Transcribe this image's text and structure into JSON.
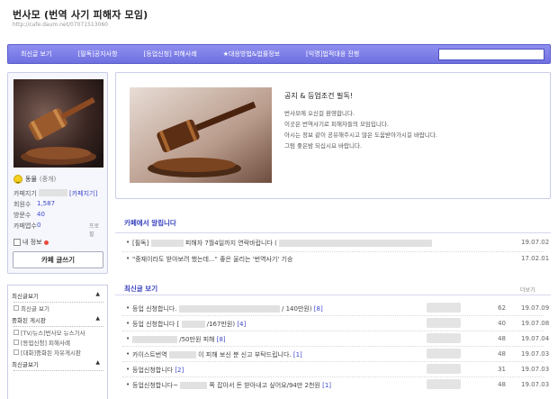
{
  "header": {
    "title": "번사모 (번역 사기 피해자 모임)",
    "url": "http://cafe.daum.net/07071513060"
  },
  "nav": {
    "items": [
      "최신글 보기",
      "[필독]공지사항",
      "[등업신청] 피해사례",
      "★대응방법&법률정보",
      "[익명]법적대응 진행"
    ],
    "search_placeholder": ""
  },
  "profile": {
    "level_label": "동물",
    "level_suffix": "(중개)",
    "stats": [
      {
        "key": "카페지기",
        "value": "[카페지기]"
      },
      {
        "key": "회원수",
        "value": "1,587"
      },
      {
        "key": "방문수",
        "value": "40"
      },
      {
        "key": "카페앱수",
        "value": "0"
      }
    ],
    "manage": "프로필",
    "my_write": "내 정보",
    "write_button": "카페 글쓰기"
  },
  "menu": {
    "sections": [
      {
        "title": "최신글보기",
        "items": [
          "최신글 보기"
        ]
      },
      {
        "title": "중화된 게시판",
        "items": [
          "[TV/뉴스]번사모 뉴스기사",
          "[등업신청] 피해사례",
          "[대화]중화된 자유게시판"
        ]
      },
      {
        "title": "최신글보기",
        "items": []
      }
    ]
  },
  "notice": {
    "title": "공지 & 등업조건 필독!",
    "lines": [
      "번사모에 오신걸 환영합니다.",
      "이곳은 번역사기로 피해자들의 모임입니다.",
      "아시는 정보 같이 공유해주시고 많은 도움받아가시길 바랍니다.",
      "그럼 좋은밤 되십시요 바랍니다."
    ]
  },
  "cafe_notice": {
    "title": "카페에서 알립니다",
    "rows": [
      {
        "text": "[필독]",
        "after": "피해자 7월4일까지 연락바랍니다 (",
        "date": "19.07.02"
      },
      {
        "text": "\"중재이라도 받아보려 했는데...\" 좋은 울리는 '번역사기' 기승",
        "after": "",
        "date": "17.02.01"
      }
    ]
  },
  "recent": {
    "title": "최신글 보기",
    "more": "더보기",
    "rows": [
      {
        "text": "등업 신청합니다.",
        "mid": "/ 140만원)",
        "count": "[8]",
        "num": "62",
        "date": "19.07.09"
      },
      {
        "text": "등업 신청합니다 [",
        "mid": "/167만원)",
        "count": "[4]",
        "num": "40",
        "date": "19.07.08"
      },
      {
        "text": "",
        "mid": "/50만원 피해",
        "count": "[8]",
        "num": "48",
        "date": "19.07.04"
      },
      {
        "text": "카이스트번역",
        "mid": "이 피해 보신 분 신고 부탁드립니다.",
        "count": "[1]",
        "num": "48",
        "date": "19.07.03"
      },
      {
        "text": "등업신청합니다",
        "mid": "",
        "count": "[2]",
        "num": "31",
        "date": "19.07.03"
      },
      {
        "text": "등업신청합니다~",
        "mid": "쪽 잡아서 돈 받아내고 싶어요/94만 2천원",
        "count": "[1]",
        "num": "48",
        "date": "19.07.03"
      }
    ]
  },
  "colors": {
    "nav": "#7b7de8",
    "accent": "#3943bd"
  }
}
